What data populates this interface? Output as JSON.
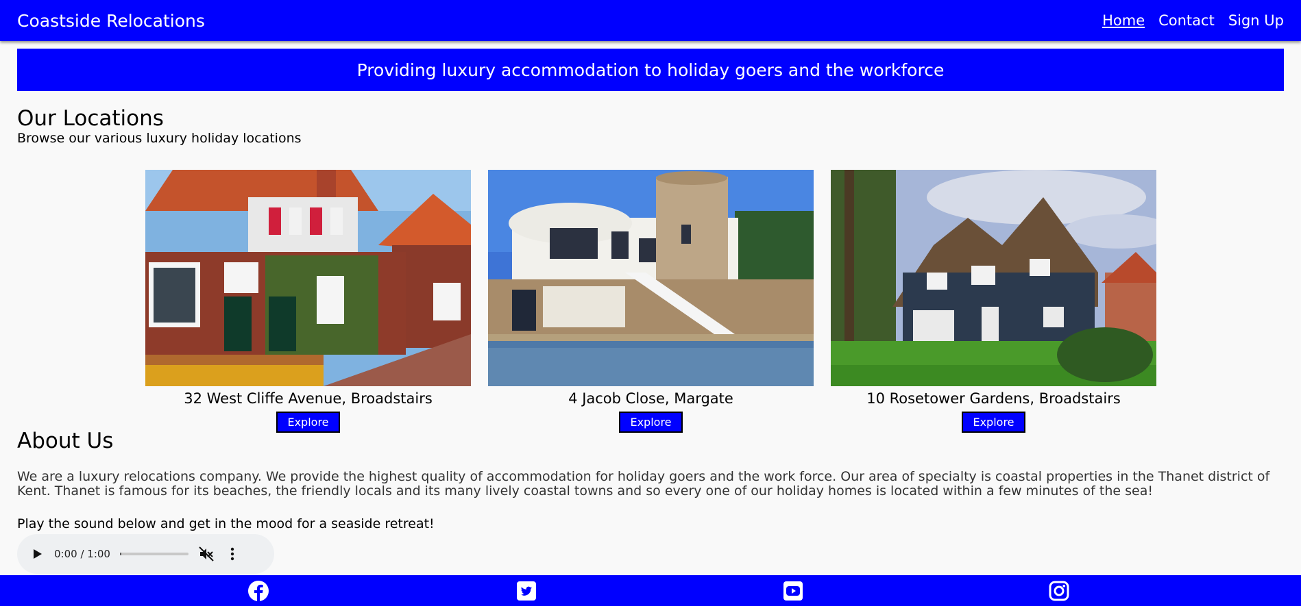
{
  "header": {
    "brand": "Coastside Relocations",
    "nav": [
      {
        "label": "Home",
        "active": true
      },
      {
        "label": "Contact",
        "active": false
      },
      {
        "label": "Sign Up",
        "active": false
      }
    ]
  },
  "banner": {
    "text": "Providing luxury accommodation to holiday goers and the workforce"
  },
  "locations": {
    "title": "Our Locations",
    "subtitle": "Browse our various luxury holiday locations",
    "items": [
      {
        "name": "32 West Cliffe Avenue, Broadstairs",
        "button": "Explore"
      },
      {
        "name": "4 Jacob Close, Margate",
        "button": "Explore"
      },
      {
        "name": "10 Rosetower Gardens, Broadstairs",
        "button": "Explore"
      }
    ]
  },
  "about": {
    "title": "About Us",
    "text": "We are a luxury relocations company. We provide the highest quality of accommodation for holiday goers and the work force. Our area of specialty is coastal properties in the Thanet district of Kent. Thanet is famous for its beaches, the friendly locals and its many lively coastal towns and so every one of our holiday homes is located within a few minutes of the sea!",
    "prompt": "Play the sound below and get in the mood for a seaside retreat!"
  },
  "audio": {
    "time": "0:00 / 1:00",
    "progress": 0.0
  },
  "footer": {
    "icons": [
      "facebook-icon",
      "twitter-icon",
      "youtube-icon",
      "instagram-icon"
    ]
  },
  "colors": {
    "brand_blue": "#0000ff",
    "background": "#f9f9f9"
  }
}
